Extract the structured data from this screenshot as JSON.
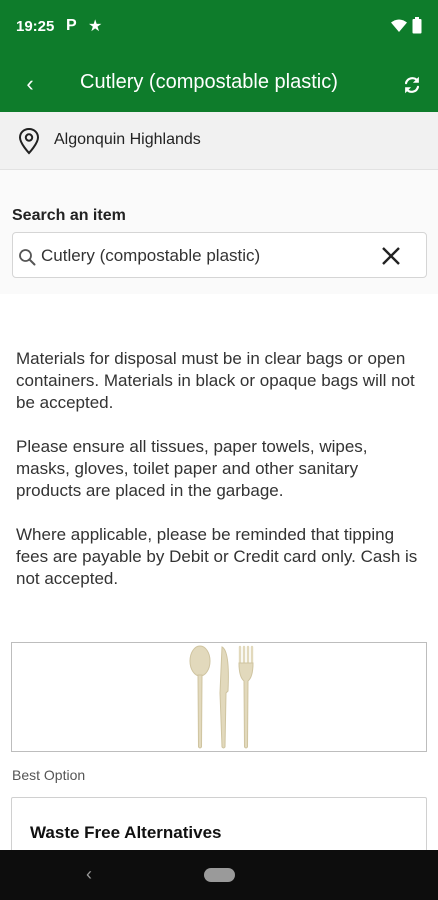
{
  "status_bar": {
    "time": "19:25",
    "notification_p": "P",
    "notification_star": "★"
  },
  "app_bar": {
    "back_glyph": "‹",
    "title": "Cutlery (compostable plastic)",
    "icons": [
      "back-icon",
      "refresh-icon"
    ]
  },
  "location": {
    "icon": "map-pin-icon",
    "name": "Algonquin Highlands"
  },
  "search": {
    "label": "Search an item",
    "value": "Cutlery (compostable plastic)",
    "icon": "search-icon",
    "clear_icon": "close-icon"
  },
  "notice": {
    "paragraphs": [
      "Materials for disposal must be in clear bags or open containers. Materials in black or opaque bags will not be accepted.",
      "Please ensure all tissues, paper towels, wipes, masks, gloves, toilet paper and other sanitary products are placed in the garbage.",
      "Where applicable, please be reminded that tipping fees are payable by Debit or Credit card only.  Cash is not accepted."
    ]
  },
  "item_image": {
    "icon": "cutlery-image"
  },
  "best_option": {
    "label": "Best Option",
    "card_title": "Waste Free Alternatives"
  },
  "nav_bar": {
    "back_glyph": "‹"
  },
  "colors": {
    "primary": "#0e7c2b",
    "location_bg": "#f1f1f1",
    "search_bg": "#fafafa",
    "nav_bg": "#0d0d0d",
    "cutlery": "#e2d9bc"
  }
}
